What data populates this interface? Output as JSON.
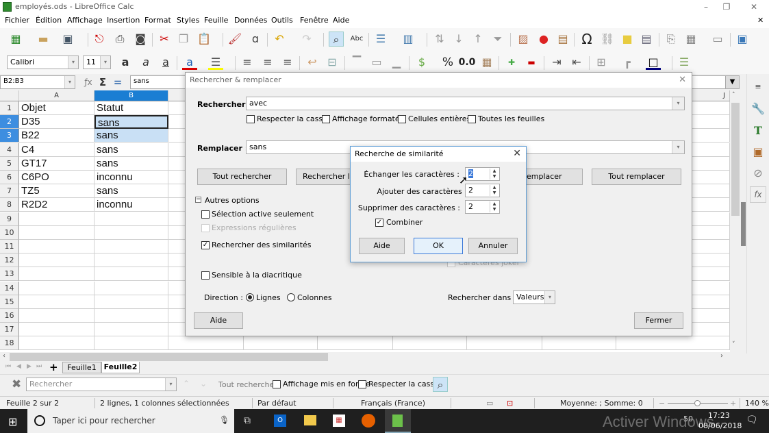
{
  "window": {
    "title": "employés.ods - LibreOffice Calc",
    "minimize": "–",
    "maximize": "❐",
    "close": "✕",
    "doc_close": "✕"
  },
  "menu": [
    "Fichier",
    "Édition",
    "Affichage",
    "Insertion",
    "Format",
    "Styles",
    "Feuille",
    "Données",
    "Outils",
    "Fenêtre",
    "Aide"
  ],
  "format_toolbar": {
    "font_name": "Calibri",
    "font_size": "11",
    "percent": "%",
    "number_format": "0.0"
  },
  "formula_bar": {
    "name_box": "B2:B3",
    "content": "sans"
  },
  "sheet": {
    "columns": [
      "A",
      "B",
      "",
      "",
      "",
      "",
      "",
      "",
      "J"
    ],
    "rows": [
      {
        "num": "1",
        "a": "Objet",
        "b": "Statut"
      },
      {
        "num": "2",
        "a": "D35",
        "b": "sans"
      },
      {
        "num": "3",
        "a": "B22",
        "b": "sans"
      },
      {
        "num": "4",
        "a": "C4",
        "b": "sans"
      },
      {
        "num": "5",
        "a": "GT17",
        "b": "sans"
      },
      {
        "num": "6",
        "a": "C6PO",
        "b": "inconnu"
      },
      {
        "num": "7",
        "a": "TZ5",
        "b": "sans"
      },
      {
        "num": "8",
        "a": "R2D2",
        "b": "inconnu"
      },
      {
        "num": "9",
        "a": "",
        "b": ""
      },
      {
        "num": "10",
        "a": "",
        "b": ""
      },
      {
        "num": "11",
        "a": "",
        "b": ""
      },
      {
        "num": "12",
        "a": "",
        "b": ""
      },
      {
        "num": "13",
        "a": "",
        "b": ""
      },
      {
        "num": "14",
        "a": "",
        "b": ""
      },
      {
        "num": "15",
        "a": "",
        "b": ""
      },
      {
        "num": "16",
        "a": "",
        "b": ""
      },
      {
        "num": "17",
        "a": "",
        "b": ""
      },
      {
        "num": "18",
        "a": "",
        "b": ""
      }
    ],
    "selected_range": "B2:B3"
  },
  "find_replace": {
    "title": "Rechercher & remplacer",
    "search_label": "Rechercher :",
    "search_value": "avec",
    "replace_label": "Remplacer :",
    "replace_value": "sans",
    "options": {
      "match_case": {
        "label": "Respecter la casse",
        "checked": false
      },
      "formatted_display": {
        "label": "Affichage formaté",
        "checked": false
      },
      "entire_cells": {
        "label": "Cellules entières",
        "checked": false
      },
      "all_sheets": {
        "label": "Toutes les feuilles",
        "checked": false
      }
    },
    "buttons": {
      "find_all": "Tout rechercher",
      "find_prev": "Rechercher le p",
      "replace": "emplacer",
      "replace_all": "Tout remplacer",
      "help": "Aide",
      "close": "Fermer"
    },
    "other_options": "Autres options",
    "current_selection": {
      "label": "Sélection active seulement",
      "checked": false
    },
    "regex": {
      "label": "Expressions régulières",
      "checked": false,
      "disabled": true
    },
    "similarity": {
      "label": "Rechercher des similarités",
      "checked": true
    },
    "wildcards": {
      "label": "Caractères joker",
      "checked": false
    },
    "diacritic": {
      "label": "Sensible à la diacritique",
      "checked": false
    },
    "direction_label": "Direction :",
    "direction_rows": "Lignes",
    "direction_cols": "Colonnes",
    "direction_selected": "rows",
    "search_in_label": "Rechercher dans :",
    "search_in_value": "Valeurs"
  },
  "similarity_dialog": {
    "title": "Recherche de similarité",
    "exchange_label": "Échanger les caractères :",
    "exchange_value": "2",
    "add_label": "Ajouter des caractères :",
    "add_value": "2",
    "remove_label": "Supprimer des caractères :",
    "remove_value": "2",
    "combine": {
      "label": "Combiner",
      "checked": true
    },
    "buttons": {
      "help": "Aide",
      "ok": "OK",
      "cancel": "Annuler"
    }
  },
  "sheet_tabs": [
    "Feuille1",
    "Feuille2"
  ],
  "active_sheet": "Feuille2",
  "find_toolbar": {
    "placeholder": "Rechercher",
    "find_all": "Tout rechercher",
    "formatted": "Affichage mis en forme",
    "match_case": "Respecter la casse"
  },
  "status_bar": {
    "sheet": "Feuille 2 sur 2",
    "selection": "2 lignes, 1 colonnes sélectionnées",
    "style": "Par défaut",
    "language": "Français (France)",
    "sum": "Moyenne: ; Somme: 0",
    "zoom": "140 %",
    "zoom_minus": "−",
    "zoom_plus": "+"
  },
  "taskbar": {
    "search_placeholder": "Taper ici pour rechercher",
    "time": "17:23",
    "date": "08/06/2018",
    "watermark": "Activer Windows",
    "battery": "50"
  }
}
